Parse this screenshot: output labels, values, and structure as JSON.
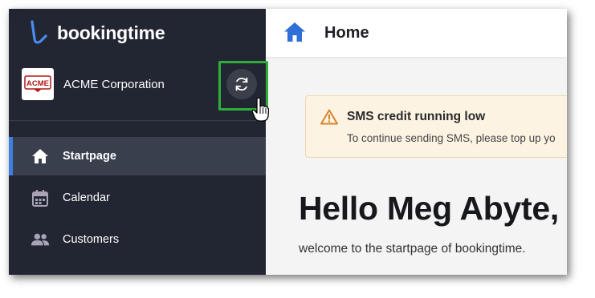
{
  "app": {
    "brand_name": "bookingtime",
    "accent": "#3d7fe0",
    "sidebar_bg": "#222633"
  },
  "account": {
    "company_name": "ACME Corporation",
    "logo_text": "ACME",
    "switch_icon": "refresh-icon"
  },
  "sidebar": {
    "items": [
      {
        "label": "Startpage",
        "icon": "home-icon",
        "active": true
      },
      {
        "label": "Calendar",
        "icon": "calendar-icon",
        "active": false
      },
      {
        "label": "Customers",
        "icon": "people-icon",
        "active": false
      }
    ]
  },
  "header": {
    "title": "Home",
    "icon": "home-icon"
  },
  "alert": {
    "title": "SMS credit running low",
    "text": "To continue sending SMS, please top up yo",
    "icon": "warning-icon",
    "color": "#d9822b"
  },
  "main": {
    "greeting": "Hello Meg Abyte,",
    "welcome": "welcome to the startpage of bookingtime."
  },
  "annotation": {
    "highlight_color": "#2fae3a"
  }
}
